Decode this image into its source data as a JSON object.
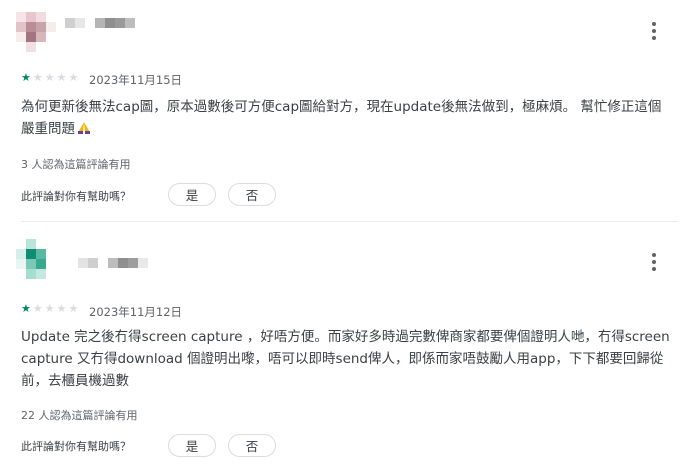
{
  "reviews": [
    {
      "rating": 1,
      "max_rating": 5,
      "date": "2023年11月15日",
      "text": "為何更新後無法cap圖，原本過數後可方便cap圖給對方，現在update後無法做到，極麻煩。 幫忙修正這個嚴重問題",
      "emoji": "🙏",
      "helpful_count": "3 人認為這篇評論有用",
      "helpful_question": "此評論對你有幫助嗎？",
      "yes_label": "是",
      "no_label": "否",
      "avatar_colors": [
        "#f6e4e7",
        "#e7c7cd",
        "#f1dde0",
        "#ffffff",
        "#e0c4c9",
        "#b88d95",
        "#c9a3aa",
        "#f5ecee",
        "#f7edef",
        "#a27580",
        "#d8b6bc",
        "#ffffff",
        "#ffffff",
        "#efe0e3",
        "#ffffff",
        "#ffffff"
      ],
      "name_colors": [
        "#cfcfcf",
        "#e6e6e6",
        "#ffffff",
        "#b5b5b5",
        "#8f8f8f",
        "#9a9a9a",
        "#bdbdbd"
      ]
    },
    {
      "rating": 1,
      "max_rating": 5,
      "date": "2023年11月12日",
      "text": "Update 完之後冇得screen capture ，好唔方便。而家好多時過完數俾商家都要俾個證明人哋，冇得screen capture 又冇得download 個證明出嚟，唔可以即時send俾人，即係而家唔鼓勵人用app，下下都要回歸從前，去櫃員機過數",
      "helpful_count": "22 人認為這篇評論有用",
      "helpful_question": "此評論對你有幫助嗎？",
      "yes_label": "是",
      "no_label": "否",
      "avatar_colors": [
        "#ffffff",
        "#b9e5da",
        "#ffffff",
        "#ffffff",
        "#d4efe8",
        "#0f8c72",
        "#58b8a1",
        "#ffffff",
        "#e7f6f2",
        "#79c9b6",
        "#3aa88e",
        "#ffffff",
        "#ffffff",
        "#a6ddd0",
        "#c3e8df",
        "#ffffff"
      ],
      "name_colors": [
        "#e3e3e3",
        "#cfcfcf",
        "#ffffff",
        "#bdbdbd",
        "#8f8f8f",
        "#9d9d9d",
        "#e9e9e9"
      ]
    }
  ]
}
